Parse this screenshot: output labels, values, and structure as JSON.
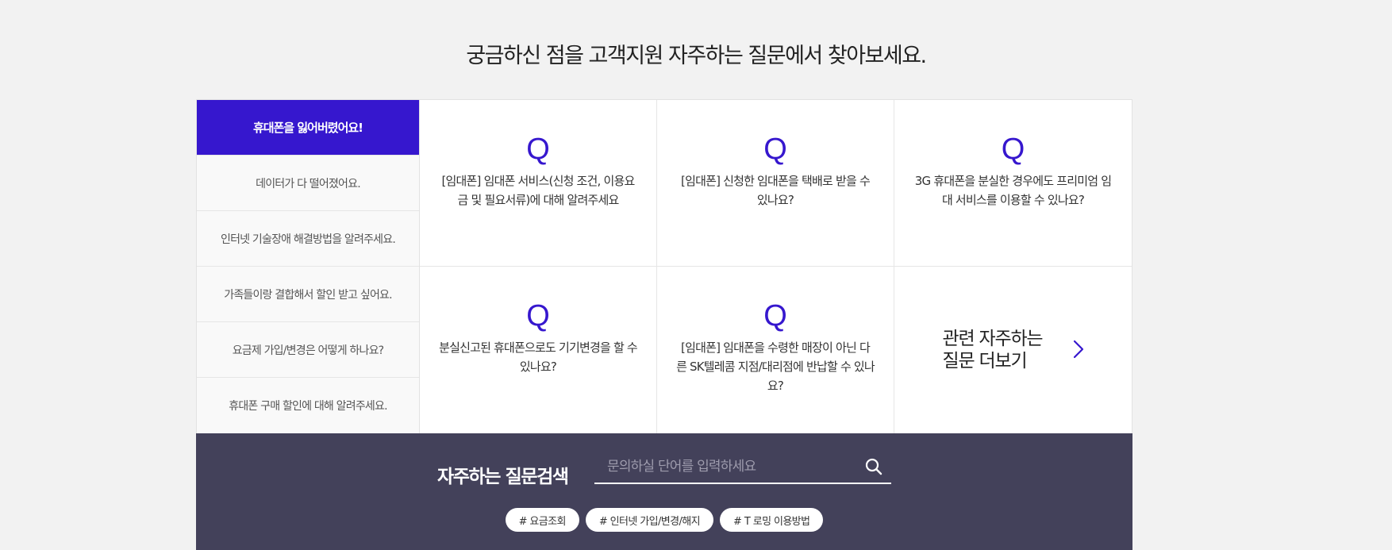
{
  "heading": "궁금하신 점을 고객지원 자주하는 질문에서 찾아보세요.",
  "menu": {
    "items": [
      {
        "label": "휴대폰을 잃어버렸어요!"
      },
      {
        "label": "데이터가 다 떨어졌어요."
      },
      {
        "label": "인터넷 기술장애 해결방법을 알려주세요."
      },
      {
        "label": "가족들이랑 결합해서 할인 받고 싶어요."
      },
      {
        "label": "요금제 가입/변경은 어떻게 하나요?"
      },
      {
        "label": "휴대폰 구매 할인에 대해 알려주세요."
      }
    ]
  },
  "faq": {
    "q_symbol": "Q",
    "items": [
      {
        "text": "[임대폰] 임대폰 서비스(신청 조건, 이용요금 및 필요서류)에 대해 알려주세요"
      },
      {
        "text": "[임대폰] 신청한 임대폰을 택배로 받을 수 있나요?"
      },
      {
        "text": "3G 휴대폰을 분실한 경우에도 프리미엄 임대 서비스를 이용할 수 있나요?"
      },
      {
        "text": "분실신고된 휴대폰으로도 기기변경을 할 수 있나요?"
      },
      {
        "text": "[임대폰] 임대폰을 수령한 매장이 아닌 다른 SK텔레콤 지점/대리점에 반납할 수 있나요?"
      }
    ],
    "more_label": "관련 자주하는 질문 더보기"
  },
  "search": {
    "title": "자주하는 질문검색",
    "placeholder": "문의하실 단어를 입력하세요",
    "value": "",
    "tags": [
      "# 요금조회",
      "# 인터넷 가입/변경/해지",
      "# T 로밍 이용방법"
    ]
  },
  "colors": {
    "accent": "#3617ce",
    "search_band": "#43415a",
    "background": "#f2f2f2"
  },
  "icons": {
    "search": "search-icon",
    "more": "chevron-right-icon"
  }
}
